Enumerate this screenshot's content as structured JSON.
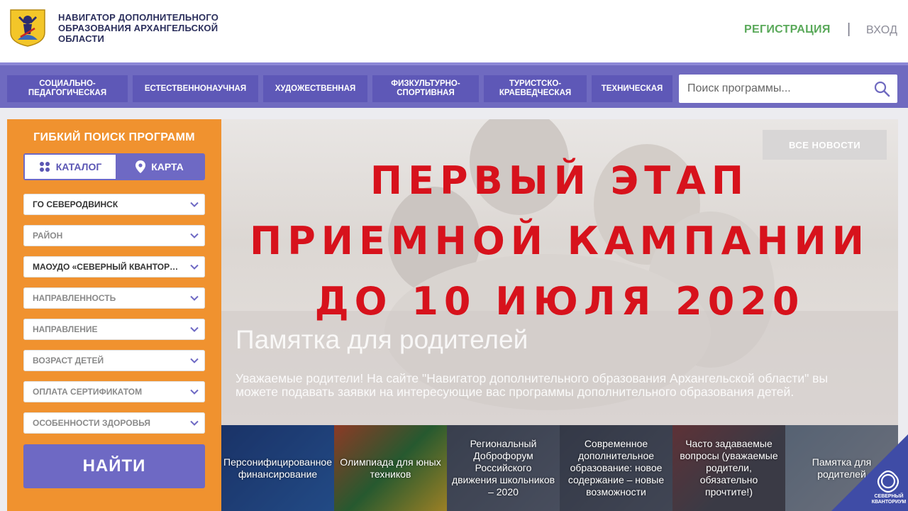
{
  "header": {
    "brand": "НАВИГАТОР ДОПОЛНИТЕЛЬНОГО ОБРАЗОВАНИЯ АРХАНГЕЛЬСКОЙ ОБЛАСТИ",
    "register": "РЕГИСТРАЦИЯ",
    "separator": "|",
    "login": "ВХОД"
  },
  "nav": {
    "items": [
      "СОЦИАЛЬНО-ПЕДАГОГИЧЕСКАЯ",
      "ЕСТЕСТВЕННОНАУЧНАЯ",
      "ХУДОЖЕСТВЕННАЯ",
      "ФИЗКУЛЬТУРНО-СПОРТИВНАЯ",
      "ТУРИСТСКО-КРАЕВЕДЧЕСКАЯ",
      "ТЕХНИЧЕСКАЯ"
    ],
    "search_placeholder": "Поиск программы..."
  },
  "sidebar": {
    "title": "ГИБКИЙ ПОИСК ПРОГРАММ",
    "toggle": {
      "catalog": "КАТАЛОГ",
      "map": "КАРТА"
    },
    "filters": [
      "ГО СЕВЕРОДВИНСК",
      "РАЙОН",
      "МАОУДО «СЕВЕРНЫЙ КВАНТОРИУМ»",
      "НАПРАВЛЕННОСТЬ",
      "НАПРАВЛЕНИЕ",
      "ВОЗРАСТ ДЕТЕЙ",
      "ОПЛАТА СЕРТИФИКАТОМ",
      "ОСОБЕННОСТИ ЗДОРОВЬЯ"
    ],
    "find": "НАЙТИ"
  },
  "hero": {
    "all_news": "ВСЕ НОВОСТИ",
    "headline": [
      "ПЕРВЫЙ ЭТАП",
      "ПРИЕМНОЙ КАМПАНИИ",
      "ДО 10 ИЮЛЯ 2020"
    ],
    "news_title": "Памятка для родителей",
    "news_desc": "Уважаемые родители! На сайте \"Навигатор дополнительного образования Архангельской области\" вы можете подавать заявки на интересующие вас программы дополнительного образования детей."
  },
  "tiles": [
    "Персонифицированное финансирование",
    "Олимпиада для юных техников",
    "Региональный Доброфорум Российского движения школьников – 2020",
    "Современное дополнительное образование: новое содержание – новые возможности",
    "Часто задаваемые вопросы (уважаемые родители, обязательно прочтите!)",
    "Памятка для родителей"
  ],
  "corner_logo": "СЕВЕРНЫЙ КВАНТОРИУМ",
  "colors": {
    "nav_bg": "#6f6ac0",
    "accent_orange": "#f0922f",
    "headline_red": "#d7121c",
    "register_green": "#5aa95a"
  }
}
